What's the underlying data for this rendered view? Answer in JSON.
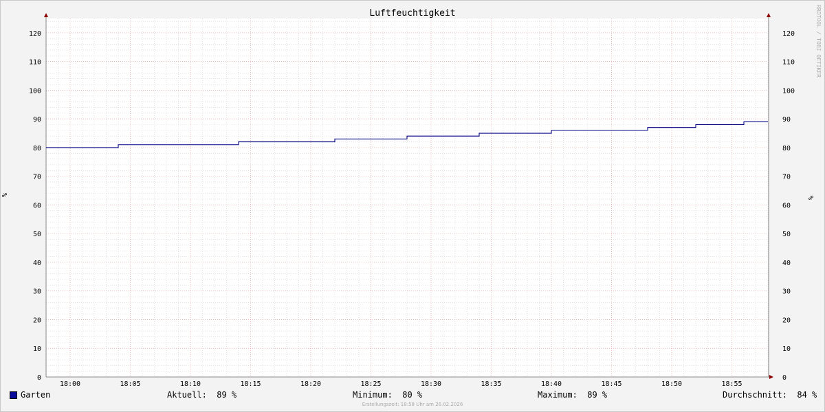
{
  "chart_data": {
    "type": "line",
    "title": "Luftfeuchtigkeit",
    "ylabel": "%",
    "ylim": [
      0,
      125
    ],
    "y_ticks": [
      0,
      10,
      20,
      30,
      40,
      50,
      60,
      70,
      80,
      90,
      100,
      110,
      120
    ],
    "x_range": [
      "17:58",
      "18:58"
    ],
    "x_ticks": [
      "18:00",
      "18:05",
      "18:10",
      "18:15",
      "18:20",
      "18:25",
      "18:30",
      "18:35",
      "18:40",
      "18:45",
      "18:50",
      "18:55"
    ],
    "grid": true,
    "legend_position": "bottom-left",
    "series": [
      {
        "name": "Garten",
        "color": "#000080",
        "step": true,
        "points": [
          {
            "x": "17:58",
            "y": 80
          },
          {
            "x": "18:04",
            "y": 81
          },
          {
            "x": "18:14",
            "y": 82
          },
          {
            "x": "18:22",
            "y": 83
          },
          {
            "x": "18:28",
            "y": 84
          },
          {
            "x": "18:34",
            "y": 85
          },
          {
            "x": "18:40",
            "y": 86
          },
          {
            "x": "18:48",
            "y": 87
          },
          {
            "x": "18:52",
            "y": 88
          },
          {
            "x": "18:56",
            "y": 89
          },
          {
            "x": "18:58",
            "y": 89
          }
        ]
      }
    ]
  },
  "watermark": "RRDTOOL / TOBI OETIKER",
  "legend": {
    "series_name": "Garten",
    "current": "Aktuell:  89 %",
    "minimum": "Minimum:  80 %",
    "maximum": "Maximum:  89 %",
    "average": "Durchschnitt:  84 %"
  },
  "footer": "Erstellungszeit: 18:58 Uhr am 26.02.2026",
  "colors": {
    "background": "#f3f3f3",
    "plot": "#ffffff",
    "major_grid": "#e8a0a0",
    "minor_grid": "#cfcfcf",
    "axis_arrow": "#8b0000",
    "series": "#000080"
  }
}
